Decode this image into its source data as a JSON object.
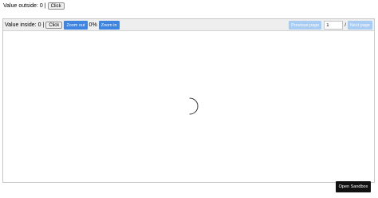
{
  "outside": {
    "label": "Value outside:",
    "value": "0",
    "separator": "|",
    "button_label": "Click"
  },
  "toolbar": {
    "inside_label": "Value inside:",
    "inside_value": "0",
    "separator": "|",
    "click_label": "Click",
    "zoom_out_label": "Zoom out",
    "zoom_level": "0%",
    "zoom_in_label": "Zoom in",
    "previous_page_label": "Previous page",
    "page_number": "1",
    "page_slash": "/",
    "next_page_label": "Next page"
  },
  "sandbox": {
    "open_label": "Open Sandbox"
  },
  "colors": {
    "primary_button": "#3d85e0",
    "disabled_button": "#a9ccf2",
    "sandbox_button": "#111111"
  },
  "icons": {
    "loading": "spinner-icon"
  }
}
